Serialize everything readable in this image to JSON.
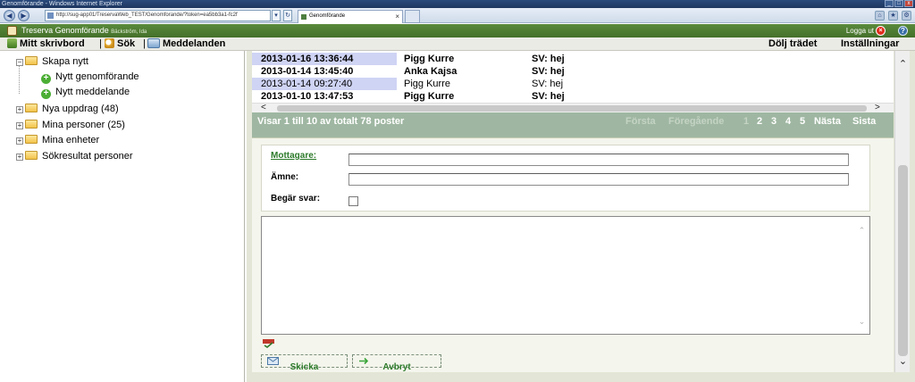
{
  "browser": {
    "window_title": "Genomförande - Windows Internet Explorer",
    "address": "http://sug-app01/TreservaWeb_TEST/Genomforande/?token=ea5bb3a1-fc2f",
    "tab_label": "Genomförande"
  },
  "header": {
    "app_title": "Treserva Genomförande",
    "user_name": "Bäckström, Ida",
    "logout_label": "Logga ut"
  },
  "toolbar": {
    "desk_label": "Mitt skrivbord",
    "search_label": "Sök",
    "messages_label": "Meddelanden",
    "hide_tree_label": "Dölj trädet",
    "settings_label": "Inställningar"
  },
  "tree": {
    "create_new": "Skapa nytt",
    "new_execution": "Nytt genomförande",
    "new_message": "Nytt meddelande",
    "new_assignments": "Nya uppdrag (48)",
    "my_persons": "Mina personer (25)",
    "my_units": "Mina enheter",
    "search_results": "Sökresultat personer"
  },
  "grid": {
    "rows": [
      {
        "date": "2013-01-16 13:36:44",
        "name": "Pigg Kurre",
        "subject": "SV: hej"
      },
      {
        "date": "2013-01-14 13:45:40",
        "name": "Anka Kajsa",
        "subject": "SV: hej"
      },
      {
        "date": "2013-01-14 09:27:40",
        "name": "Pigg Kurre",
        "subject": "SV: hej"
      },
      {
        "date": "2013-01-10 13:47:53",
        "name": "Pigg Kurre",
        "subject": "SV: hej"
      }
    ],
    "pager_text": "Visar 1 till 10 av totalt 78 poster",
    "first": "Första",
    "previous": "Föregående",
    "pages": [
      "1",
      "2",
      "3",
      "4",
      "5"
    ],
    "next": "Nästa",
    "last": "Sista"
  },
  "compose": {
    "recipient_label": "Mottagare:",
    "recipient_value": "",
    "subject_label": "Ämne:",
    "subject_value": "",
    "request_reply_label": "Begär svar:",
    "message_body": "",
    "send_label": "Skicka",
    "cancel_label": "Avbryt"
  }
}
